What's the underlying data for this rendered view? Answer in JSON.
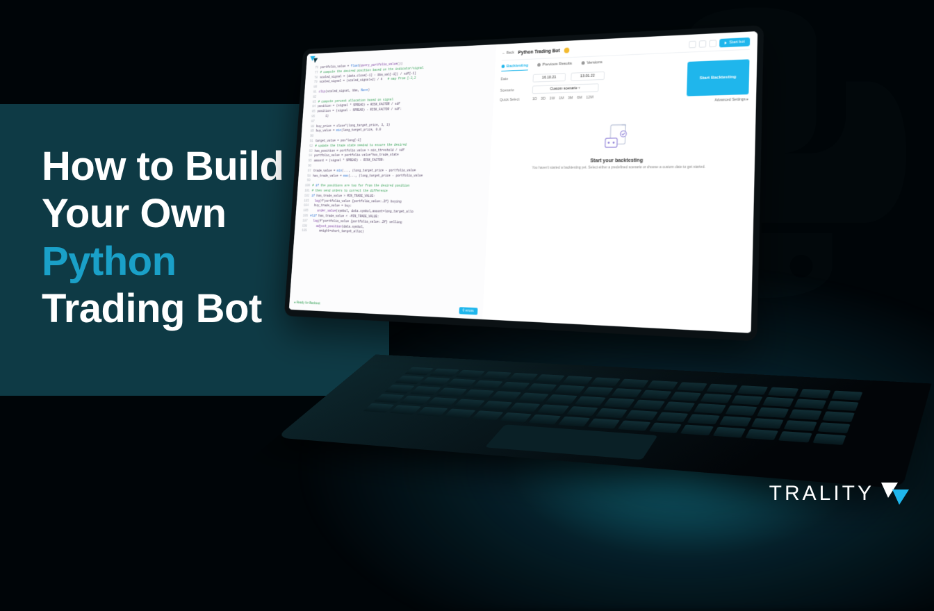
{
  "headline": {
    "line1": "How to Build",
    "line2": "Your Own",
    "accent": "Python",
    "line4": "Trading Bot"
  },
  "brand": {
    "name": "TRALITY"
  },
  "screen": {
    "back": "← Back",
    "title": "Python Trading Bot",
    "start_bot": "Start bot",
    "tabs": {
      "backtesting": "Backtesting",
      "previous": "Previous Results",
      "versions": "Versions"
    },
    "form": {
      "date_label": "Date",
      "date_from": "16.10.21",
      "date_to": "13.01.22",
      "scenario_label": "Scenario",
      "scenario_value": "Custom scenario",
      "quick_label": "Quick Select",
      "quick_opts": [
        "1D",
        "3D",
        "1W",
        "1M",
        "3M",
        "6M",
        "12M"
      ]
    },
    "cta": "Start Backtesting",
    "advanced": "Advanced Settings ▸",
    "empty_title": "Start your backtesting",
    "empty_sub": "You haven't started a backtesting yet. Select either a predefined scenario or choose a custom date to get started.",
    "footer_ready": "● Ready for Backtest",
    "footer_errors": "0 errors"
  },
  "code_preview": [
    "portfolio_value = float(query_portfolio_value())",
    "# compute the desired position based on the indicator/signal",
    "scaled_signal = (data.close[-1] - bbm_val[-1]) / sdf[-1]",
    "scaled_signal = (scaled_signal+2) / 4   # map from [-2,2",
    "",
    "clip(scaled_signal, bbm, None)",
    "",
    "# compute percent allocation based on signal",
    "position = (signal * SPREAD) + RISK_FACTOR / sdf",
    "position = (signal - SPREAD) - RISK_FACTOR / sdf:",
    "     1)",
    "",
    "buy_price = close*(long_target_price, 1, 1)",
    "buy_value = min(long_target_price, 0.0",
    "",
    "target_value = pos*long[-1]",
    "# update the trade state needed to ensure the desired",
    "has_position = portfolio.value > min_threshold / sdf",
    "portfolio_value = portfolio.value*has_trade_state",
    "amount = (signal * SPREAD) - RISK_FACTOR:",
    "",
    "trade_value = min(..., (long_target_price - portfolio_value",
    "has_trade_value = max(..., (long_target_price - portfolio_value",
    "",
    "# if the positions are too far from the desired position",
    "# then send orders to correct the difference",
    "if has_trade_value > MIN_TRADE_VALUE:",
    "  log(f'portfolio_value {portfolio_value:.2f} buying",
    "  buy_trade_value = buy:",
    "    order_value(symbol, data.symbol,amount=long_target_allo",
    "elif has_trade_value < -MIN_TRADE_VALUE:",
    "  log(f'portfolio_value {portfolio_value:.2f} selling",
    "    adjust_position(data.symbol,",
    "      weight=short_target_alloc)"
  ]
}
